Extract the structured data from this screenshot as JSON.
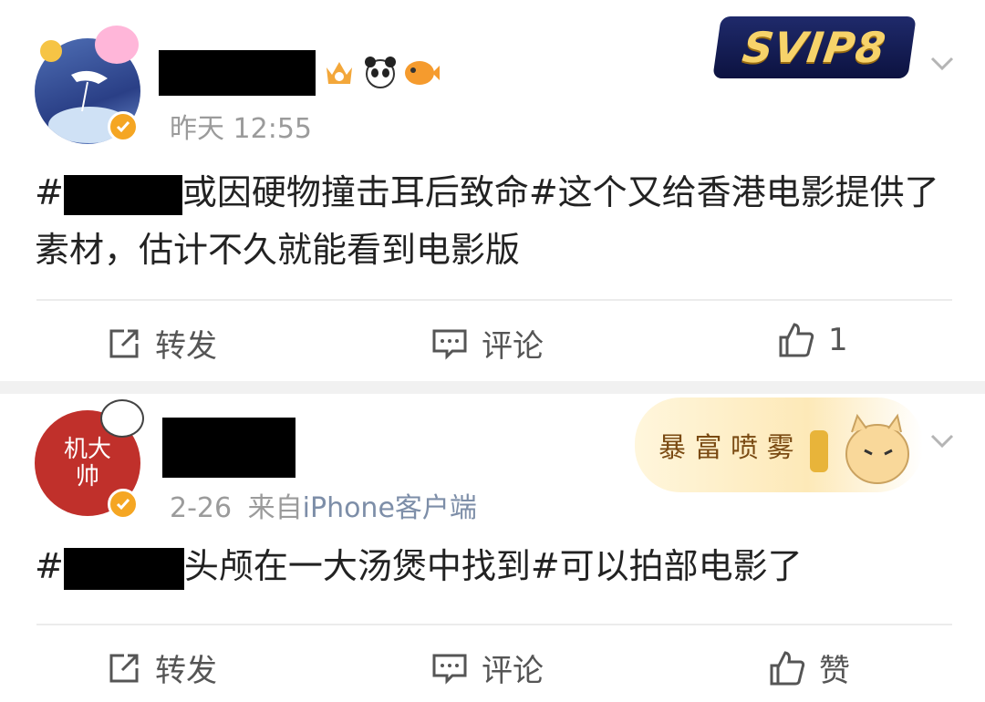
{
  "posts": [
    {
      "time": "昨天 12:55",
      "source_label": "",
      "text_prefix": "#",
      "text_main": "或因硬物撞击耳后致命#这个又给香港电影提供了素材，估计不久就能看到电影版",
      "vip_badge": "SVIP8",
      "actions": {
        "repost": "转发",
        "comment": "评论",
        "like": "1"
      }
    },
    {
      "time": "2-26",
      "source_prefix": "来自",
      "source_label": "iPhone客户端",
      "text_prefix": "#",
      "text_main": "头颅在一大汤煲中找到#可以拍部电影了",
      "card_text": "暴 富 喷 雾",
      "avatar_text": "机大帅",
      "actions": {
        "repost": "转发",
        "comment": "评论",
        "like": "赞"
      }
    }
  ],
  "colors": {
    "verified": "#f5a623",
    "svip_gold": "#f7d36a",
    "source_link": "#7d8ea8"
  }
}
